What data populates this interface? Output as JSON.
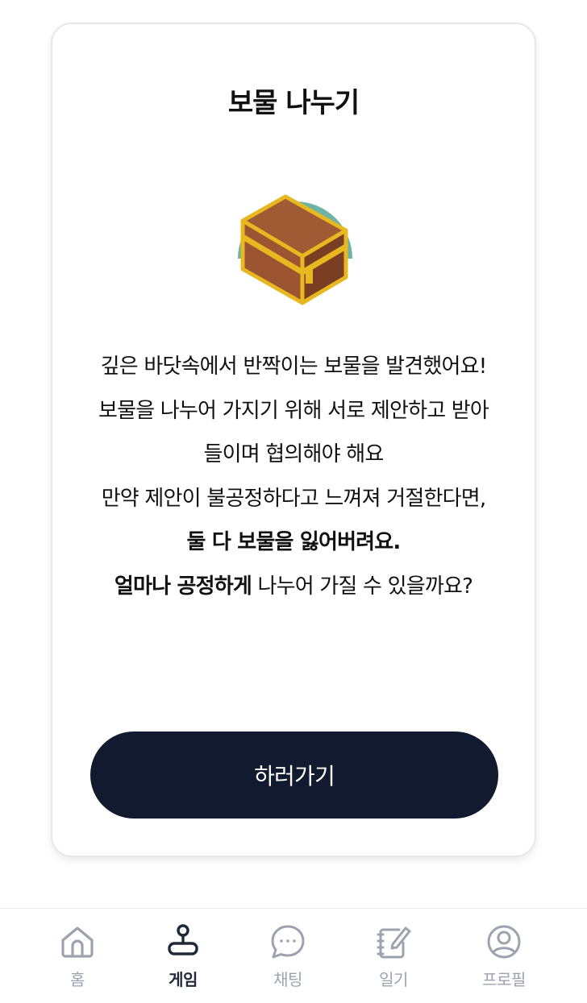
{
  "card": {
    "title": "보물 나누기",
    "description": {
      "line1": "깊은 바닷속에서 반짝이는 보물을 발견했어요!",
      "line2": "보물을 나누어 가지기 위해 서로 제안하고 받아들이며 협의해야 해요",
      "line3_plain": "만약 제안이 불공정하다고 느껴져 거절한다면, ",
      "line3_bold": "둘 다 보물을 잃어버려요.",
      "line4_bold": "얼마나 공정하게",
      "line4_plain": " 나누어 가질 수 있을까요?"
    },
    "button_label": "하러가기",
    "illustration_icon": "treasure-chest-icon"
  },
  "nav": {
    "active": "게임",
    "items": [
      {
        "label": "홈",
        "icon": "home-icon"
      },
      {
        "label": "게임",
        "icon": "joystick-icon"
      },
      {
        "label": "채팅",
        "icon": "chat-bubble-icon"
      },
      {
        "label": "일기",
        "icon": "diary-icon"
      },
      {
        "label": "프로필",
        "icon": "profile-icon"
      }
    ]
  },
  "colors": {
    "button_bg": "#111a2e",
    "nav_inactive": "#9ca3af",
    "nav_active": "#1f2937",
    "chest_wood": "#a0522d",
    "chest_trim": "#e8b820",
    "chest_backdrop": "#6db3a7"
  }
}
